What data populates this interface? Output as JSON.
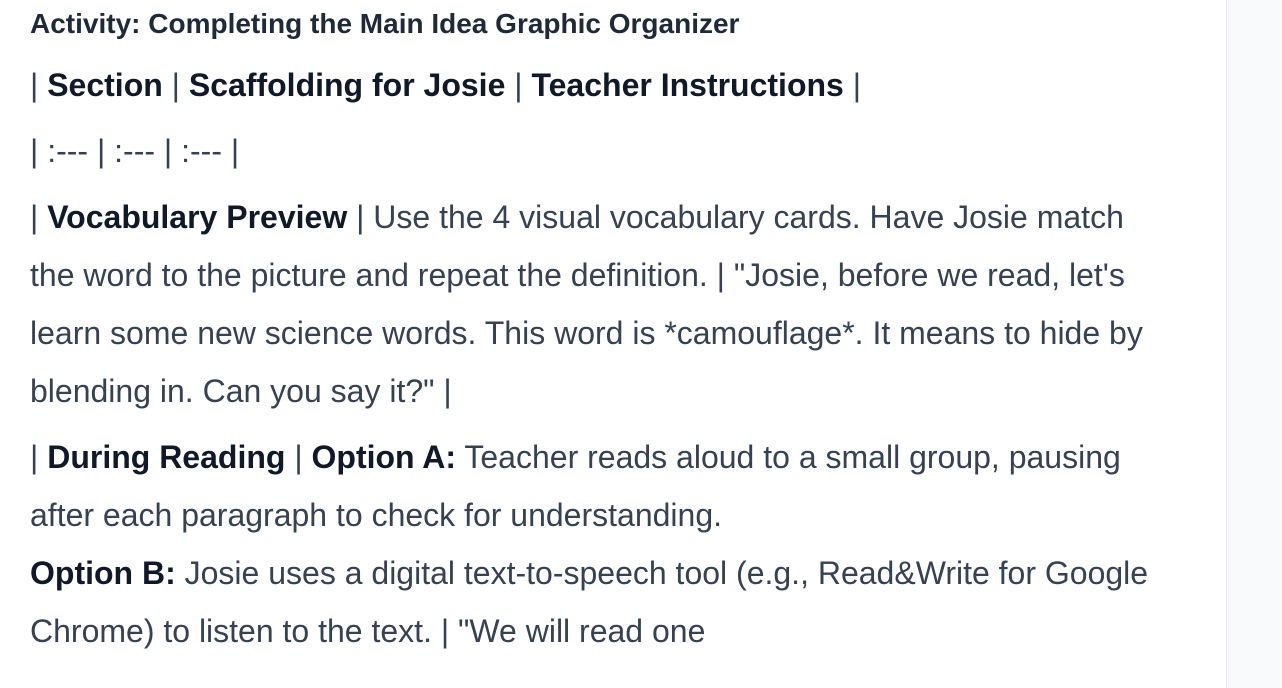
{
  "activity": {
    "title": "Activity: Completing the Main Idea Graphic Organizer"
  },
  "table": {
    "header": {
      "col1": "Section",
      "col2": "Scaffolding for Josie",
      "col3": "Teacher Instructions"
    },
    "separator": "| :--- | :--- | :--- |",
    "row1": {
      "section": "Vocabulary Preview",
      "scaffolding": " Use the 4 visual vocabulary cards. Have Josie match the word to the picture and repeat the definition. ",
      "instructions": " \"Josie, before we read, let's learn some new science words. This word is *camouflage*. It means to hide by blending in. Can you say it?\" "
    },
    "row2": {
      "section": "During Reading",
      "option_a_label": "Option A:",
      "option_a_text": " Teacher reads aloud to a small group, pausing after each paragraph to check for understanding.",
      "option_b_label": "Option B:",
      "option_b_text": " Josie uses a digital text-to-speech tool (e.g., Read&Write for Google Chrome) to listen to the text. ",
      "instructions_partial": " \"We will read one"
    }
  },
  "pipe": "|"
}
